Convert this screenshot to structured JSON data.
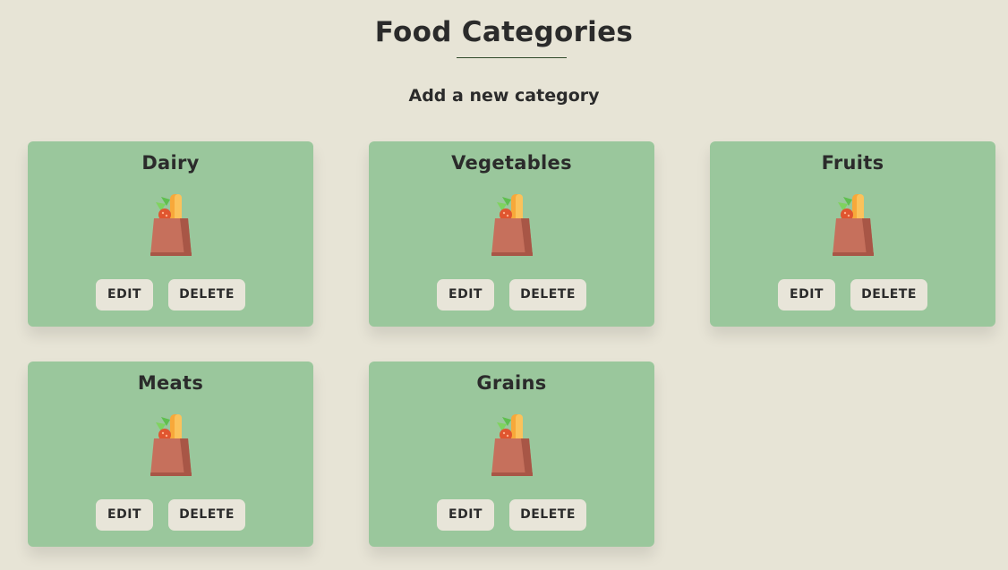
{
  "page": {
    "title": "Food Categories",
    "add_link": "Add a new category"
  },
  "colors": {
    "background": "#e7e4d6",
    "card": "#9ac79c",
    "button": "#e8e5d9",
    "text": "#2b2b2b"
  },
  "categories": [
    {
      "name": "Dairy",
      "icon": "grocery-bag-icon",
      "edit_label": "EDIT",
      "delete_label": "DELETE"
    },
    {
      "name": "Vegetables",
      "icon": "grocery-bag-icon",
      "edit_label": "EDIT",
      "delete_label": "DELETE"
    },
    {
      "name": "Fruits",
      "icon": "grocery-bag-icon",
      "edit_label": "EDIT",
      "delete_label": "DELETE"
    },
    {
      "name": "Meats",
      "icon": "grocery-bag-icon",
      "edit_label": "EDIT",
      "delete_label": "DELETE"
    },
    {
      "name": "Grains",
      "icon": "grocery-bag-icon",
      "edit_label": "EDIT",
      "delete_label": "DELETE"
    }
  ]
}
